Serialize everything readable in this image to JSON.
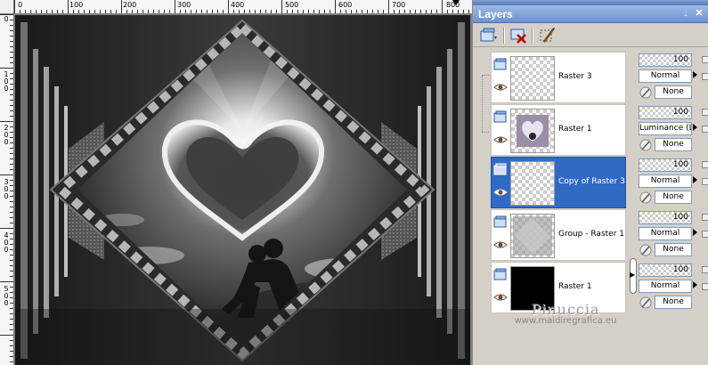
{
  "ruler": {
    "top_labels": [
      "0",
      "100",
      "200",
      "300",
      "400",
      "500",
      "600",
      "700",
      "800"
    ],
    "left_labels": [
      "0",
      "100",
      "200",
      "300",
      "400",
      "500"
    ]
  },
  "palette": {
    "title": "Layers",
    "pin_icon": "pin-icon",
    "close_icon": "close-icon",
    "title_color": "#6c92cf",
    "selected_color": "#316ac5"
  },
  "toolbar": {
    "new_layer_icon": "new-raster-layer-icon",
    "delete_icon": "delete-layer-icon",
    "edit_icon": "edit-selection-icon"
  },
  "layers": [
    {
      "name": "Raster 3",
      "opacity": "100",
      "blend": "Normal",
      "mask": "None",
      "thumb": "transparent",
      "selected": false
    },
    {
      "name": "Raster 1",
      "opacity": "100",
      "blend": "Luminance (L)",
      "mask": "None",
      "thumb": "heart-image",
      "selected": false
    },
    {
      "name": "Copy of Raster 3",
      "opacity": "100",
      "blend": "Normal",
      "mask": "None",
      "thumb": "transparent",
      "selected": true
    },
    {
      "name": "Group - Raster 1",
      "opacity": "100",
      "blend": "Normal",
      "mask": "None",
      "thumb": "gray-pattern",
      "selected": false
    },
    {
      "name": "Raster 1",
      "opacity": "100",
      "blend": "Normal",
      "mask": "None",
      "thumb": "black",
      "selected": false
    }
  ],
  "watermark": {
    "name": "Pinuccia",
    "url": "www.maidiregrafica.eu"
  }
}
